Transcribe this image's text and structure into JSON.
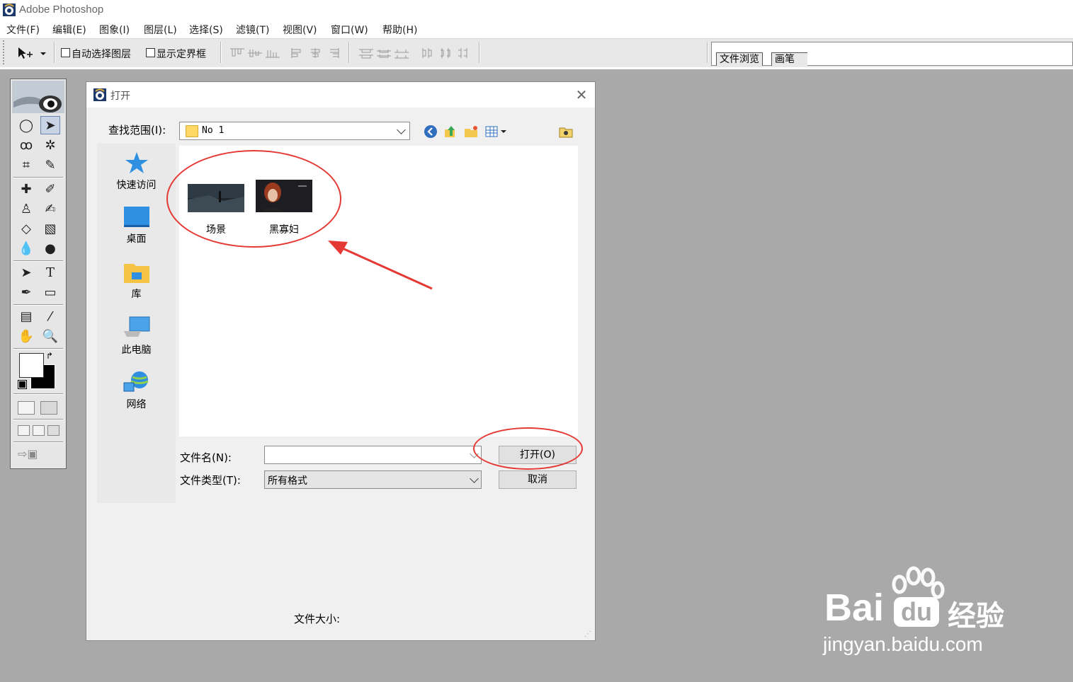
{
  "app": {
    "title": "Adobe Photoshop"
  },
  "menu": [
    "文件(F)",
    "编辑(E)",
    "图象(I)",
    "图层(L)",
    "选择(S)",
    "滤镜(T)",
    "视图(V)",
    "窗口(W)",
    "帮助(H)"
  ],
  "options": {
    "auto_select_layer": "自动选择图层",
    "show_bounding_box": "显示定界框"
  },
  "palette_well": {
    "tabs": [
      "文件浏览",
      "画笔"
    ]
  },
  "dialog": {
    "title": "打开",
    "look_in_label": "查找范围(I):",
    "look_in_value": "No 1",
    "places": [
      "快速访问",
      "桌面",
      "库",
      "此电脑",
      "网络"
    ],
    "files": [
      "场景",
      "黑寡妇"
    ],
    "filename_label": "文件名(N):",
    "filename_value": "",
    "filetype_label": "文件类型(T):",
    "filetype_value": "所有格式",
    "open_button": "打开(O)",
    "cancel_button": "取消",
    "filesize_label": "文件大小:"
  },
  "watermark": {
    "brand": "Bai",
    "brand_suffix": "经验",
    "url": "jingyan.baidu.com"
  },
  "colors": {
    "annotation": "#e53935",
    "workspace": "#a9a9a9"
  }
}
